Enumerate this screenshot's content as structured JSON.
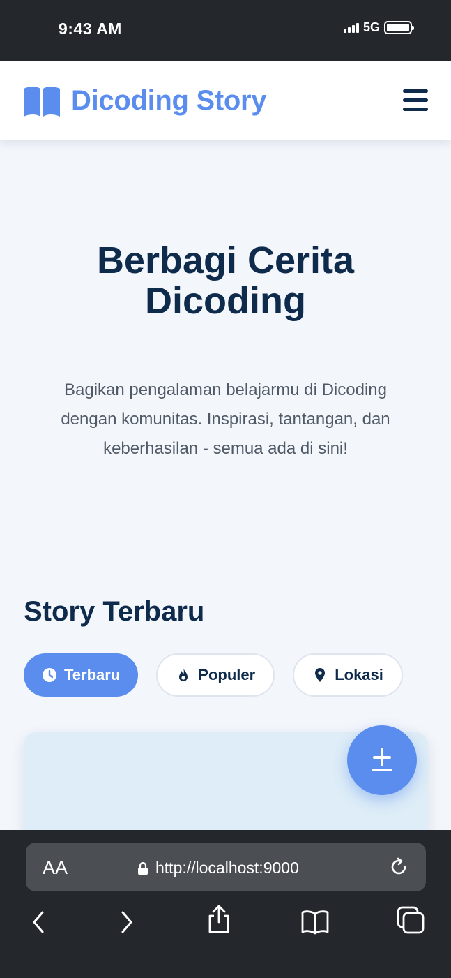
{
  "status_bar": {
    "time": "9:43 AM",
    "network": "5G"
  },
  "header": {
    "brand": "Dicoding Story"
  },
  "hero": {
    "title_line1": "Berbagi Cerita",
    "title_line2": "Dicoding",
    "description": "Bagikan pengalaman belajarmu di Dicoding dengan komunitas. Inspirasi, tantangan, dan keberhasilan - semua ada di sini!"
  },
  "stories": {
    "title": "Story Terbaru",
    "filters": [
      {
        "label": "Terbaru",
        "icon": "clock-icon",
        "active": true
      },
      {
        "label": "Populer",
        "icon": "fire-icon",
        "active": false
      },
      {
        "label": "Lokasi",
        "icon": "location-pin-icon",
        "active": false
      }
    ]
  },
  "browser": {
    "text_size_label": "AA",
    "url": "http://localhost:9000"
  },
  "colors": {
    "accent": "#5b8def",
    "heading": "#0f2b4c",
    "background": "#f3f6fb",
    "browser_chrome": "#24282c"
  }
}
